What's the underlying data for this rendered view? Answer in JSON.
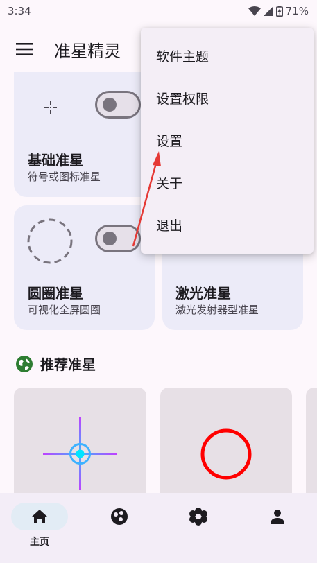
{
  "status_bar": {
    "time": "3:34",
    "battery": "71%"
  },
  "app_bar": {
    "title": "准星精灵"
  },
  "cards": [
    {
      "title": "基础准星",
      "subtitle": "符号或图标准星",
      "icon": "crosshair-dot-icon"
    },
    {
      "title": "圆圈准星",
      "subtitle": "可视化全屏圆圈",
      "icon": "dashed-circle-icon"
    },
    {
      "title": "激光准星",
      "subtitle": "激光发射器型准星"
    }
  ],
  "section": {
    "title": "推荐准星",
    "icon": "globe-icon"
  },
  "recommended": [
    {
      "icon": "blue-crosshair-icon",
      "color": "#3db2ff"
    },
    {
      "icon": "red-circle-icon",
      "color": "#ff0000"
    }
  ],
  "bottom_nav": [
    {
      "label": "主页",
      "icon": "home-icon",
      "active": true
    },
    {
      "label": "",
      "icon": "palette-icon"
    },
    {
      "label": "",
      "icon": "flower-icon"
    },
    {
      "label": "",
      "icon": "person-icon"
    }
  ],
  "dropdown": {
    "items": [
      {
        "label": "软件主题"
      },
      {
        "label": "设置权限"
      },
      {
        "label": "设置"
      },
      {
        "label": "关于"
      },
      {
        "label": "退出"
      }
    ]
  },
  "colors": {
    "accent_arrow": "#e53935",
    "card_bg": "#ecebf8",
    "nav_bg": "#f3edf7"
  }
}
